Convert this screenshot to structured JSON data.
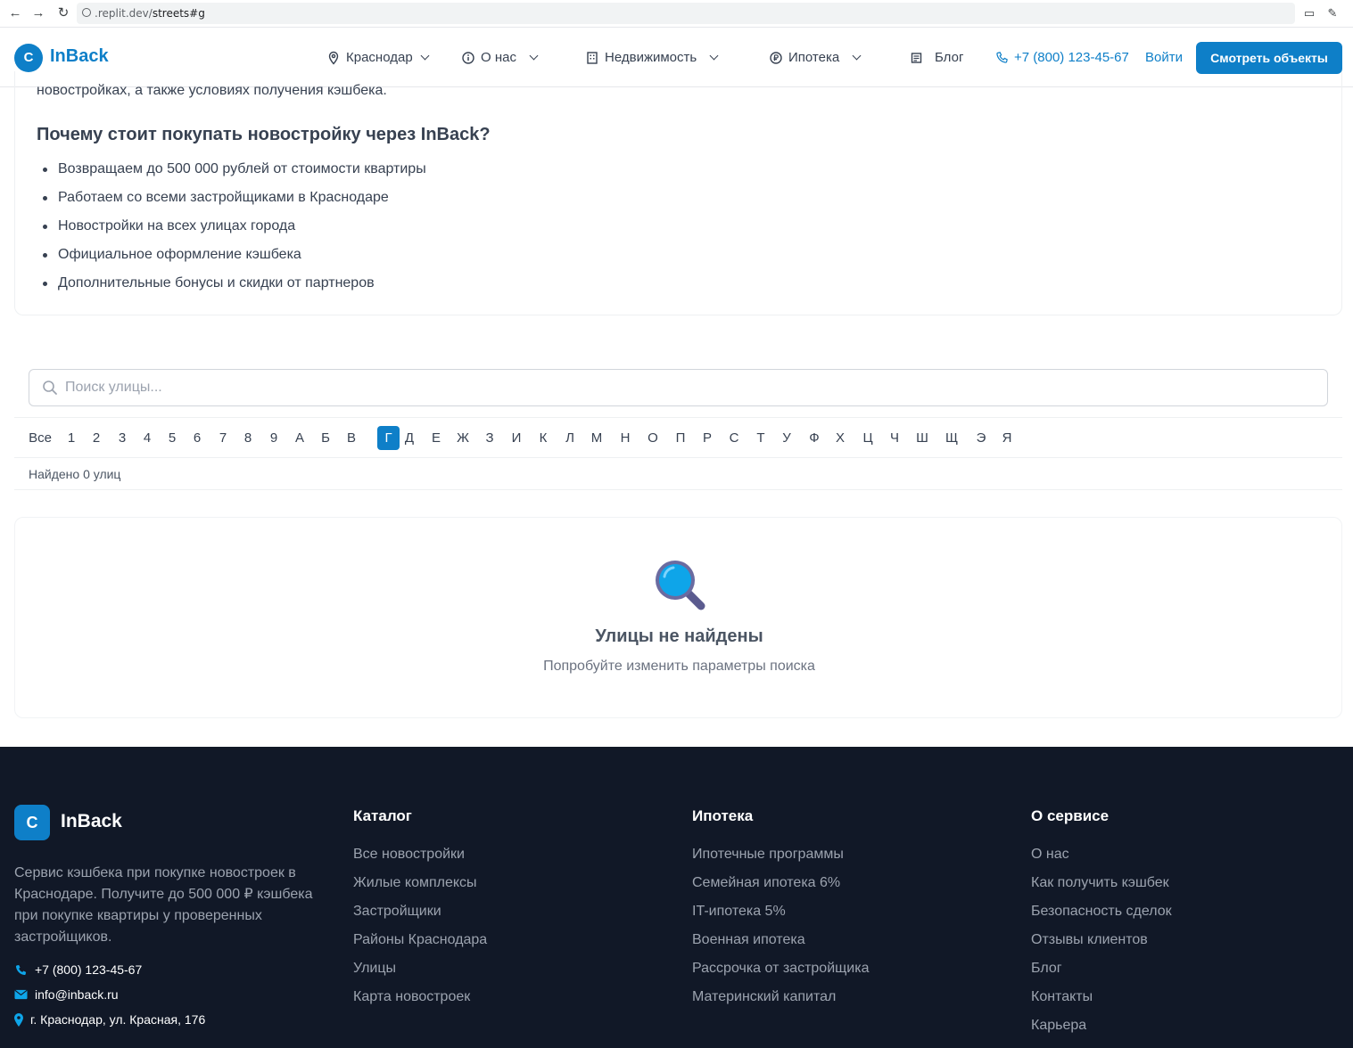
{
  "browser": {
    "url_prefix": ".replit.dev/",
    "url_path": "streets#g"
  },
  "header": {
    "logo_letter": "С",
    "logo_text": "InBack",
    "nav": [
      {
        "label": "Краснодар",
        "icon": "location-pin-icon"
      },
      {
        "label": "О нас",
        "icon": "info-icon"
      },
      {
        "label": "Недвижимость",
        "icon": "building-icon"
      },
      {
        "label": "Ипотека",
        "icon": "ruble-coin-icon"
      },
      {
        "label": "Блог",
        "icon": "newspaper-icon"
      }
    ],
    "phone": "+7 (800) 123-45-67",
    "login": "Войти",
    "cta": "Смотреть объекты"
  },
  "info": {
    "top_text": "новостройках, а также условиях получения кэшбека.",
    "heading": "Почему стоит покупать новостройку через InBack?",
    "bullets": [
      "Возвращаем до 500 000 рублей от стоимости квартиры",
      "Работаем со всеми застройщиками в Краснодаре",
      "Новостройки на всех улицах города",
      "Официальное оформление кэшбека",
      "Дополнительные бонусы и скидки от партнеров"
    ]
  },
  "search": {
    "placeholder": "Поиск улицы...",
    "value": ""
  },
  "letters": [
    "Все",
    "1",
    "2",
    "3",
    "4",
    "5",
    "6",
    "7",
    "8",
    "9",
    "А",
    "Б",
    "В",
    "Г",
    "Д",
    "Е",
    "Ж",
    "З",
    "И",
    "К",
    "Л",
    "М",
    "Н",
    "О",
    "П",
    "Р",
    "С",
    "Т",
    "У",
    "Ф",
    "Х",
    "Ц",
    "Ч",
    "Ш",
    "Щ",
    "Э",
    "Я"
  ],
  "active_letter": "Г",
  "found_text": "Найдено 0 улиц",
  "empty": {
    "title": "Улицы не найдены",
    "subtitle": "Попробуйте изменить параметры поиска"
  },
  "footer": {
    "logo_letter": "С",
    "logo_text": "InBack",
    "description": "Сервис кэшбека при покупке новостроек в Краснодаре. Получите до 500 000 ₽ кэшбека при покупке квартиры у проверенных застройщиков.",
    "phone": "+7 (800) 123-45-67",
    "email": "info@inback.ru",
    "address": "г. Краснодар, ул. Красная, 176",
    "columns": [
      {
        "title": "Каталог",
        "links": [
          "Все новостройки",
          "Жилые комплексы",
          "Застройщики",
          "Районы Краснодара",
          "Улицы",
          "Карта новостроек"
        ]
      },
      {
        "title": "Ипотека",
        "links": [
          "Ипотечные программы",
          "Семейная ипотека 6%",
          "IT-ипотека 5%",
          "Военная ипотека",
          "Рассрочка от застройщика",
          "Материнский капитал"
        ]
      },
      {
        "title": "О сервисе",
        "links": [
          "О нас",
          "Как получить кэшбек",
          "Безопасность сделок",
          "Отзывы клиентов",
          "Блог",
          "Контакты",
          "Карьера"
        ]
      }
    ]
  },
  "colors": {
    "brand": "#0e7fc8",
    "footer_bg": "#111827"
  }
}
